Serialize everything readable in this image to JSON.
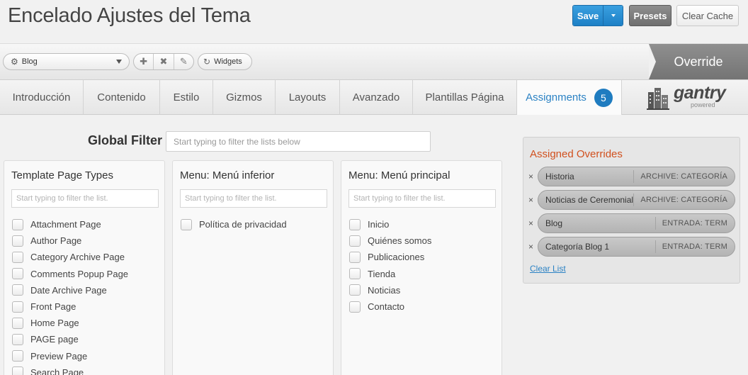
{
  "header": {
    "title": "Encelado Ajustes del Tema",
    "save_label": "Save",
    "presets_label": "Presets",
    "clear_cache_label": "Clear Cache"
  },
  "toolbar": {
    "selected_override": "Blog",
    "widgets_label": "Widgets",
    "override_label": "Override"
  },
  "tabs": [
    {
      "label": "Introducción"
    },
    {
      "label": "Contenido"
    },
    {
      "label": "Estilo"
    },
    {
      "label": "Gizmos"
    },
    {
      "label": "Layouts"
    },
    {
      "label": "Avanzado"
    },
    {
      "label": "Plantillas Página"
    },
    {
      "label": "Assignments",
      "badge": "5"
    }
  ],
  "logo": {
    "word": "gantry",
    "tagline": "powered"
  },
  "global_filter": {
    "label": "Global Filter",
    "placeholder": "Start typing to filter the lists below"
  },
  "columns": [
    {
      "title": "Template Page Types",
      "filter_placeholder": "Start typing to filter the list.",
      "items": [
        "Attachment Page",
        "Author Page",
        "Category Archive Page",
        "Comments Popup Page",
        "Date Archive Page",
        "Front Page",
        "Home Page",
        "PAGE page",
        "Preview Page",
        "Search Page"
      ]
    },
    {
      "title": "Menu: Menú inferior",
      "filter_placeholder": "Start typing to filter the list.",
      "items": [
        "Política de privacidad"
      ]
    },
    {
      "title": "Menu: Menú principal",
      "filter_placeholder": "Start typing to filter the list.",
      "items": [
        "Inicio",
        "Quiénes somos",
        "Publicaciones",
        "Tienda",
        "Noticias",
        "Contacto"
      ]
    }
  ],
  "assigned": {
    "title": "Assigned Overrides",
    "remove_symbol": "×",
    "items": [
      {
        "name": "Historia",
        "type": "ARCHIVE: CATEGORÍA"
      },
      {
        "name": "Noticias de Ceremonial",
        "type": "ARCHIVE: CATEGORÍA"
      },
      {
        "name": "Blog",
        "type": "ENTRADA: TERM"
      },
      {
        "name": "Categoría Blog 1",
        "type": "ENTRADA: TERM"
      }
    ],
    "clear_label": "Clear List"
  },
  "colors": {
    "accent": "#2b82c4",
    "save_button": "#1e80c6",
    "assigned_title": "#d1501e",
    "badge": "#1f7cc0"
  }
}
